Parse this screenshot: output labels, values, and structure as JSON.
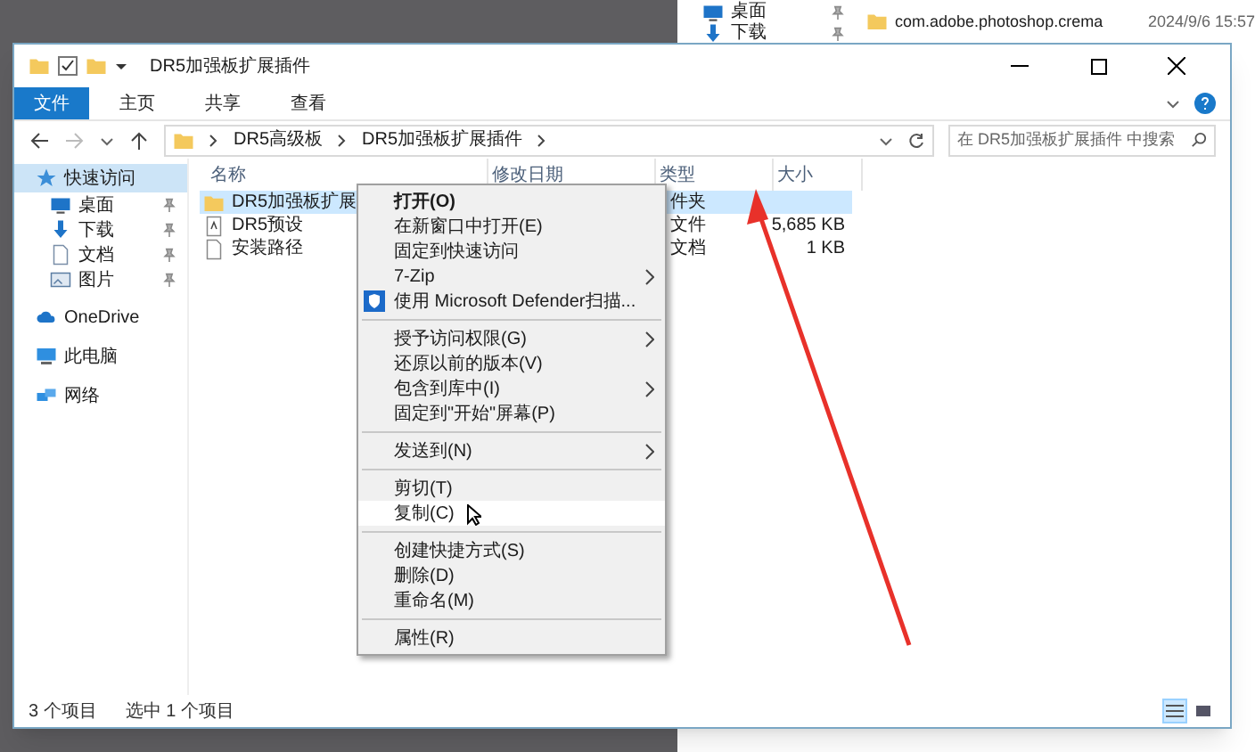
{
  "background_window": {
    "items": [
      {
        "label": "桌面",
        "pinned": true,
        "kind": "desktop"
      },
      {
        "label": "下载",
        "pinned": true,
        "kind": "download"
      }
    ],
    "files": [
      {
        "name": "com.adobe.photoshop.crema",
        "date": "2024/9/6 15:57"
      }
    ]
  },
  "window": {
    "title": "DR5加强板扩展插件"
  },
  "ribbon_tabs": [
    {
      "label": "文件",
      "selected": true
    },
    {
      "label": "主页",
      "selected": false
    },
    {
      "label": "共享",
      "selected": false
    },
    {
      "label": "查看",
      "selected": false
    }
  ],
  "address_bar": {
    "path": [
      "DR5高级板",
      "DR5加强板扩展插件"
    ]
  },
  "search": {
    "placeholder": "在 DR5加强板扩展插件 中搜索"
  },
  "sidebar": {
    "items": [
      {
        "label": "快速访问",
        "kind": "star",
        "selected": true,
        "pinned": false,
        "children": [
          {
            "label": "桌面",
            "kind": "desktop",
            "selected": false,
            "pinned": true
          },
          {
            "label": "下载",
            "kind": "download",
            "selected": false,
            "pinned": true
          },
          {
            "label": "文档",
            "kind": "document",
            "selected": false,
            "pinned": true
          },
          {
            "label": "图片",
            "kind": "picture",
            "selected": false,
            "pinned": true
          }
        ]
      },
      {
        "label": "OneDrive",
        "kind": "cloud",
        "selected": false,
        "pinned": false
      },
      {
        "label": "此电脑",
        "kind": "computer",
        "selected": false,
        "pinned": false
      },
      {
        "label": "网络",
        "kind": "network",
        "selected": false,
        "pinned": false
      }
    ]
  },
  "table": {
    "columns": [
      "名称",
      "修改日期",
      "类型",
      "大小"
    ],
    "rows": [
      {
        "name": "DR5加强板扩展",
        "kind": "folder",
        "type": "件夹",
        "size": "",
        "selected": true
      },
      {
        "name": "DR5预设",
        "kind": "archive",
        "type": "文件",
        "size": "5,685 KB",
        "selected": false
      },
      {
        "name": "安装路径",
        "kind": "text",
        "type": "文档",
        "size": "1 KB",
        "selected": false
      }
    ]
  },
  "context_menu": {
    "items": [
      {
        "kind": "item",
        "label": "打开(O)",
        "bold": true,
        "submenu": false,
        "icon": false,
        "selected": false
      },
      {
        "kind": "item",
        "label": "在新窗口中打开(E)",
        "bold": false,
        "submenu": false,
        "icon": false,
        "selected": false
      },
      {
        "kind": "item",
        "label": "固定到快速访问",
        "bold": false,
        "submenu": false,
        "icon": false,
        "selected": false
      },
      {
        "kind": "item",
        "label": "7-Zip",
        "bold": false,
        "submenu": true,
        "icon": false,
        "selected": false
      },
      {
        "kind": "item",
        "label": "使用 Microsoft Defender扫描...",
        "bold": false,
        "submenu": false,
        "icon": true,
        "selected": false
      },
      {
        "kind": "separator"
      },
      {
        "kind": "item",
        "label": "授予访问权限(G)",
        "bold": false,
        "submenu": true,
        "icon": false,
        "selected": false
      },
      {
        "kind": "item",
        "label": "还原以前的版本(V)",
        "bold": false,
        "submenu": false,
        "icon": false,
        "selected": false
      },
      {
        "kind": "item",
        "label": "包含到库中(I)",
        "bold": false,
        "submenu": true,
        "icon": false,
        "selected": false
      },
      {
        "kind": "item",
        "label": "固定到\"开始\"屏幕(P)",
        "bold": false,
        "submenu": false,
        "icon": false,
        "selected": false
      },
      {
        "kind": "separator"
      },
      {
        "kind": "item",
        "label": "发送到(N)",
        "bold": false,
        "submenu": true,
        "icon": false,
        "selected": false
      },
      {
        "kind": "separator"
      },
      {
        "kind": "item",
        "label": "剪切(T)",
        "bold": false,
        "submenu": false,
        "icon": false,
        "selected": false
      },
      {
        "kind": "item",
        "label": "复制(C)",
        "bold": false,
        "submenu": false,
        "icon": false,
        "selected": true
      },
      {
        "kind": "separator"
      },
      {
        "kind": "item",
        "label": "创建快捷方式(S)",
        "bold": false,
        "submenu": false,
        "icon": false,
        "selected": false
      },
      {
        "kind": "item",
        "label": "删除(D)",
        "bold": false,
        "submenu": false,
        "icon": false,
        "selected": false
      },
      {
        "kind": "item",
        "label": "重命名(M)",
        "bold": false,
        "submenu": false,
        "icon": false,
        "selected": false
      },
      {
        "kind": "separator"
      },
      {
        "kind": "item",
        "label": "属性(R)",
        "bold": false,
        "submenu": false,
        "icon": false,
        "selected": false
      }
    ]
  },
  "status_bar": {
    "item_count": "3 个项目",
    "selection": "选中 1 个项目"
  },
  "view_buttons": [
    {
      "kind": "details",
      "selected": true
    },
    {
      "kind": "tiles",
      "selected": false
    }
  ]
}
